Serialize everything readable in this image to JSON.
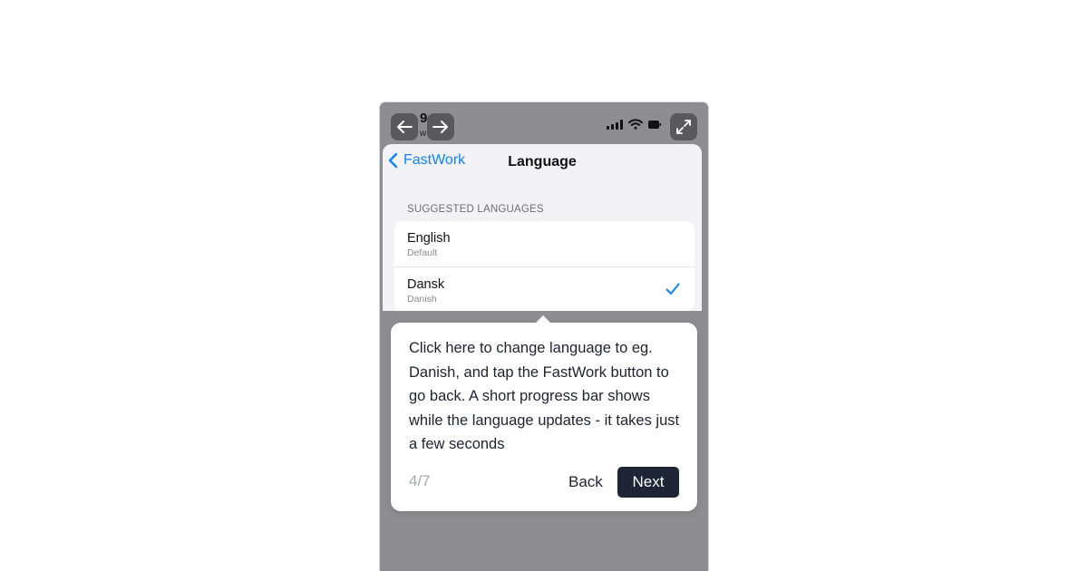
{
  "status_bar": {
    "time": "9",
    "sub": "w",
    "icons": [
      "signal-icon",
      "wifi-icon",
      "battery-icon"
    ]
  },
  "controls": {
    "icons": [
      "arrow-left-icon",
      "arrow-right-icon",
      "expand-icon"
    ]
  },
  "nav": {
    "back_label": "FastWork",
    "title": "Language"
  },
  "section": {
    "header": "SUGGESTED LANGUAGES"
  },
  "languages": [
    {
      "name": "English",
      "sub": "Default",
      "selected": false
    },
    {
      "name": "Dansk",
      "sub": "Danish",
      "selected": true
    }
  ],
  "tooltip": {
    "text": "Click here to change language to eg. Danish, and tap the FastWork button to go back. A short progress bar shows while the language updates - it takes just a few seconds",
    "step": "4/7",
    "back_label": "Back",
    "next_label": "Next"
  },
  "colors": {
    "accent": "#0a84ff",
    "primary_button": "#1d2536",
    "overlay": "#8e8e92"
  }
}
